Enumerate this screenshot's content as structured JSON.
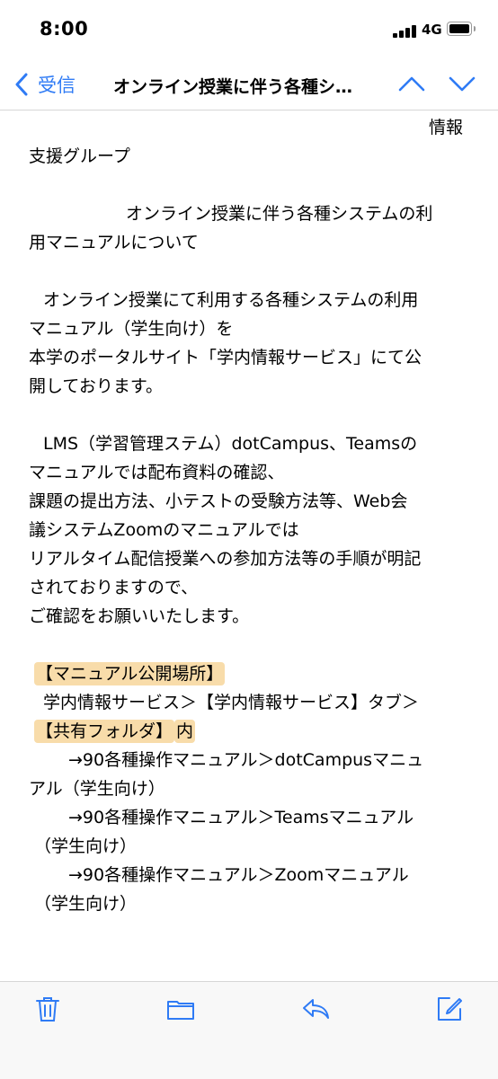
{
  "status": {
    "time": "8:00",
    "network": "4G"
  },
  "nav": {
    "back_label": "受信",
    "title": "オンライン授業に伴う各種シ…"
  },
  "mail": {
    "lines": [
      "情報",
      "支援グループ",
      "オンライン授業に伴う各種システムの利",
      "用マニュアルについて",
      "オンライン授業にて利用する各種システムの利用",
      "マニュアル（学生向け）を",
      "本学のポータルサイト「学内情報サービス」にて公",
      "開しております。",
      "LMS（学習管理ステム）dotCampus、Teamsの",
      "マニュアルでは配布資料の確認、",
      "課題の提出方法、小テストの受験方法等、Web会",
      "議システムZoomのマニュアルでは",
      "リアルタイム配信授業への参加方法等の手順が明記",
      "されておりますので、",
      "ご確認をお願いいたします。",
      "【マニュアル公開場所】",
      "学内情報サービス＞【学内情報サービス】タブ＞",
      "【共有フォルダ】",
      "内",
      "→90各種操作マニュアル＞dotCampusマニュ",
      "アル（学生向け）",
      "→90各種操作マニュアル＞Teamsマニュアル",
      "（学生向け）",
      "→90各種操作マニュアル＞Zoomマニュアル",
      "（学生向け）"
    ]
  },
  "colors": {
    "accent": "#2f7bf5",
    "highlight": "#f8dcaa"
  },
  "toolbar": {
    "icons": [
      "trash-icon",
      "folder-icon",
      "reply-icon",
      "compose-icon"
    ]
  }
}
